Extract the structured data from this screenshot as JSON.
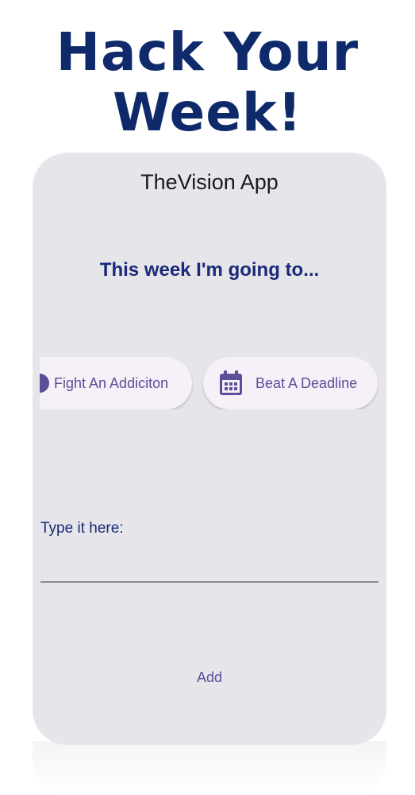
{
  "promo": {
    "headline_line1": "Hack Your",
    "headline_line2": "Week!"
  },
  "app": {
    "title": "TheVision App",
    "prompt": "This week I'm going to..."
  },
  "chips": [
    {
      "label": "Fight An Addiciton",
      "icon": "circle-icon"
    },
    {
      "label": "Beat A Deadline",
      "icon": "calendar-icon"
    }
  ],
  "input": {
    "label": "Type it here:",
    "value": ""
  },
  "actions": {
    "add_label": "Add"
  },
  "colors": {
    "headline": "#0f2a6b",
    "accent": "#5b4f97",
    "prompt": "#1b2a78",
    "card_bg": "#e6e5ea",
    "chip_bg": "#f6f0f8"
  }
}
